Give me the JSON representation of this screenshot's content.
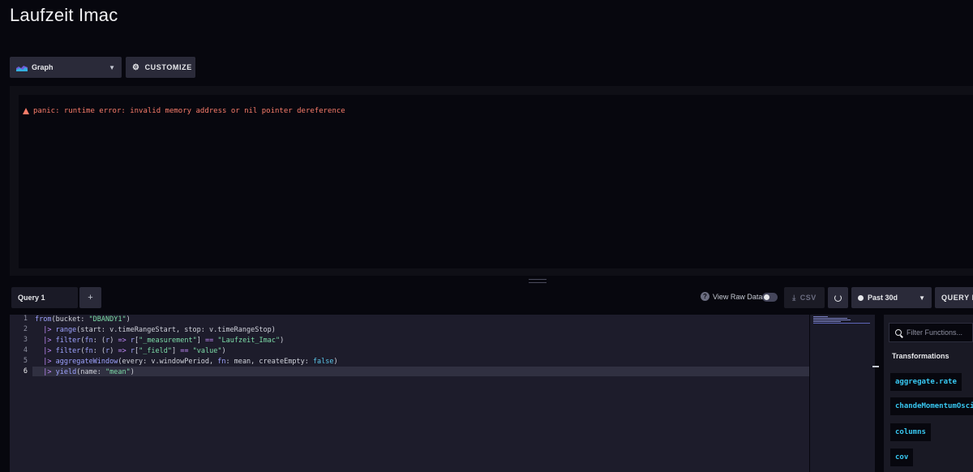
{
  "page": {
    "title": "Laufzeit Imac"
  },
  "toolbar": {
    "visualization_label": "Graph",
    "customize_label": "CUSTOMIZE"
  },
  "error": {
    "message": "panic: runtime error: invalid memory address or nil pointer dereference"
  },
  "query_bar": {
    "tab_label": "Query 1",
    "add_label": "+",
    "raw_data_label": "View Raw Data",
    "csv_label": "CSV",
    "time_range": "Past 30d",
    "submit_label": "QUERY BUILDER"
  },
  "editor": {
    "line_numbers": [
      "1",
      "2",
      "3",
      "4",
      "5",
      "6"
    ],
    "active_line": "6",
    "code": [
      "from(bucket: \"DBANDY1\")",
      "  |> range(start: v.timeRangeStart, stop: v.timeRangeStop)",
      "  |> filter(fn: (r) => r[\"_measurement\"] == \"Laufzeit_Imac\")",
      "  |> filter(fn: (r) => r[\"_field\"] == \"value\")",
      "  |> aggregateWindow(every: v.windowPeriod, fn: mean, createEmpty: false)",
      "  |> yield(name: \"mean\")"
    ]
  },
  "functions_panel": {
    "search_placeholder": "Filter Functions...",
    "category": "Transformations",
    "items": [
      "aggregate.rate",
      "chandeMomentumOscillator",
      "columns",
      "cov"
    ]
  },
  "colors": {
    "background": "#07070e",
    "error": "#f97c6a",
    "function_name": "#38c8f2",
    "string": "#7ddca8"
  },
  "icons": {
    "visualization": "graph-icon",
    "customize": "gear-icon",
    "error": "warning-icon",
    "csv": "download-icon",
    "refresh": "refresh-icon",
    "time": "clock-icon",
    "search": "search-icon"
  }
}
